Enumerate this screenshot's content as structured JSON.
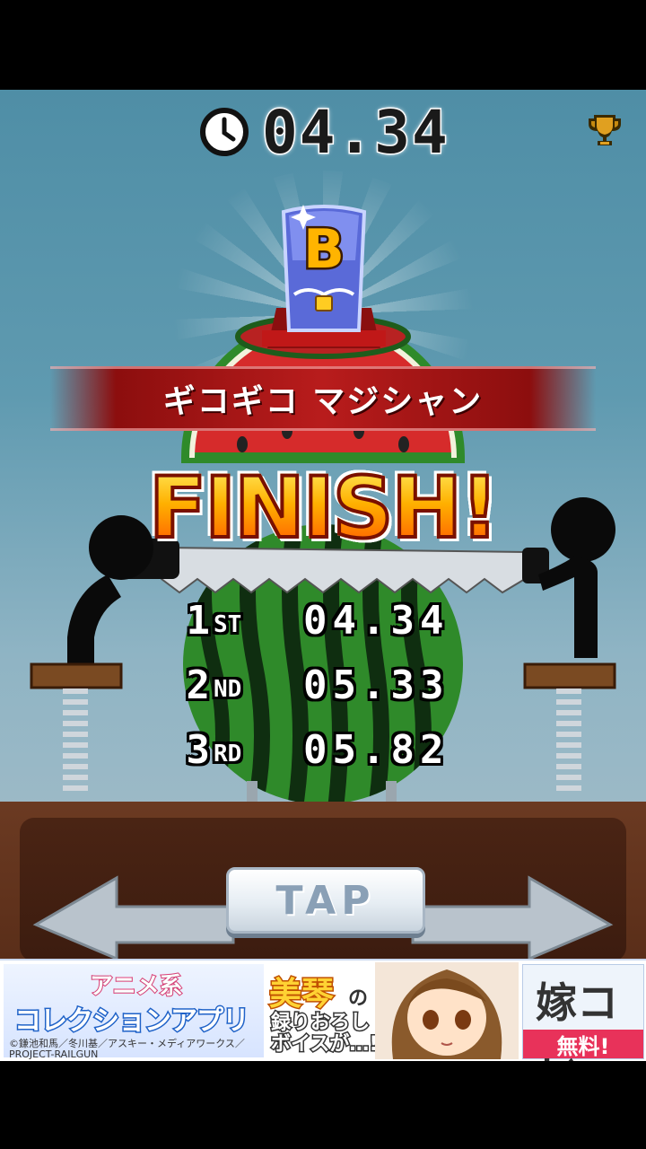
{
  "timer": {
    "icon": "clock-icon",
    "value": "04.34"
  },
  "trophy": {
    "icon": "trophy-icon"
  },
  "rank_badge": {
    "icon": "rank-badge-icon",
    "grade": "B"
  },
  "title_banner": {
    "text": "ギコギコ マジシャン"
  },
  "finish_label": "FINISH!",
  "rankings": [
    {
      "place": "1",
      "suffix": "ST",
      "time": "04.34"
    },
    {
      "place": "2",
      "suffix": "ND",
      "time": "05.33"
    },
    {
      "place": "3",
      "suffix": "RD",
      "time": "05.82"
    }
  ],
  "tap_button": {
    "label": "TAP"
  },
  "ad_banner": {
    "line1": "アニメ系",
    "line2": "コレクションアプリ",
    "credit1": "©鎌池和馬／冬川基／アスキー・メディアワークス／",
    "credit2": "PROJECT-RAILGUN",
    "headline": "美琴",
    "headline_particle": "の",
    "subline": "録りおろし\nボイスが…!!",
    "logo": "嫁コレ",
    "free_label": "無料!"
  },
  "colors": {
    "background_top": "#4f8ea6",
    "banner_red": "#b81c1c",
    "finish_orange": "#ff8a00",
    "table_brown": "#5a2e19",
    "watermelon_green": "#2f8a2a"
  }
}
